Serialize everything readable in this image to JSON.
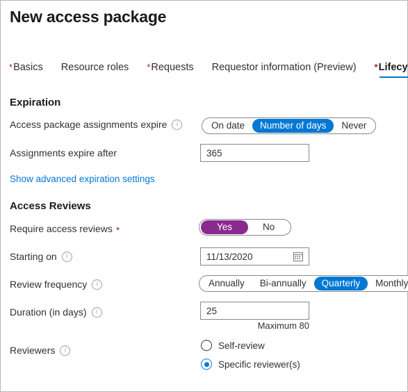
{
  "header": {
    "title": "New access package"
  },
  "tabs": [
    {
      "label": "Basics",
      "required": true,
      "active": false
    },
    {
      "label": "Resource roles",
      "required": false,
      "active": false
    },
    {
      "label": "Requests",
      "required": true,
      "active": false
    },
    {
      "label": "Requestor information (Preview)",
      "required": false,
      "active": false
    },
    {
      "label": "Lifecycle",
      "required": true,
      "active": true
    }
  ],
  "expiration": {
    "section_title": "Expiration",
    "assignments_expire": {
      "label": "Access package assignments expire",
      "info_icon": "info-icon",
      "options": [
        "On date",
        "Number of days",
        "Never"
      ],
      "selected": "Number of days"
    },
    "expire_after": {
      "label": "Assignments expire after",
      "value": "365"
    },
    "advanced_link": "Show advanced expiration settings"
  },
  "access_reviews": {
    "section_title": "Access Reviews",
    "require_reviews": {
      "label": "Require access reviews",
      "required_star": "*",
      "options": [
        "Yes",
        "No"
      ],
      "selected": "Yes"
    },
    "starting_on": {
      "label": "Starting on",
      "info_icon": "info-icon",
      "value": "11/13/2020",
      "calendar_icon": "calendar-icon"
    },
    "review_frequency": {
      "label": "Review frequency",
      "info_icon": "info-icon",
      "options": [
        "Annually",
        "Bi-annually",
        "Quarterly",
        "Monthly"
      ],
      "selected": "Quarterly"
    },
    "duration": {
      "label": "Duration (in days)",
      "info_icon": "info-icon",
      "value": "25",
      "max_hint": "Maximum 80"
    },
    "reviewers": {
      "label": "Reviewers",
      "info_icon": "info-icon",
      "options": [
        {
          "label": "Self-review",
          "checked": false
        },
        {
          "label": "Specific reviewer(s)",
          "checked": true
        }
      ]
    }
  },
  "colors": {
    "accent_blue": "#0078d4",
    "accent_purple": "#8a2a8f",
    "required_red": "#a4262c",
    "border_gray": "#8a8886"
  }
}
